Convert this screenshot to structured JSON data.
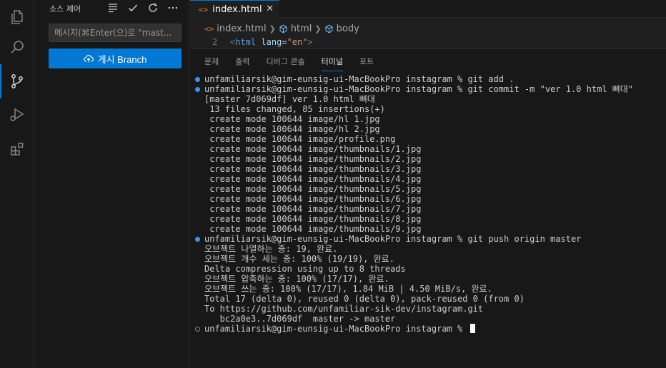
{
  "sidebar": {
    "title": "소스 제어",
    "commit_placeholder": "메시지(⌘Enter(으)로 \"master\"에 커밋)",
    "commit_display": "메시지(⌘Enter(으)로 \"mast...",
    "publish_label": "게시 Branch"
  },
  "editor": {
    "tab": {
      "label": "index.html",
      "icon": "<>",
      "close": "✕"
    },
    "breadcrumb": [
      "index.html",
      "html",
      "body"
    ],
    "code": {
      "line_number": "2",
      "text": "<html lang=\"en\">"
    }
  },
  "panel": {
    "tabs": [
      "문제",
      "출력",
      "디버그 콘솔",
      "터미널",
      "포트"
    ],
    "active_tab": "터미널"
  },
  "terminal": {
    "lines": [
      {
        "text": "unfamiliarsik@gim-eunsig-ui-MacBookPro instagram % git add .",
        "marker": "blue"
      },
      {
        "text": "unfamiliarsik@gim-eunsig-ui-MacBookPro instagram % git commit -m \"ver 1.0 html 뼈대\"",
        "marker": "blue"
      },
      {
        "text": "[master 7d069df] ver 1.0 html 뼈대",
        "marker": ""
      },
      {
        "text": " 13 files changed, 85 insertions(+)",
        "marker": ""
      },
      {
        "text": " create mode 100644 image/hl 1.jpg",
        "marker": ""
      },
      {
        "text": " create mode 100644 image/hl 2.jpg",
        "marker": ""
      },
      {
        "text": " create mode 100644 image/profile.png",
        "marker": ""
      },
      {
        "text": " create mode 100644 image/thumbnails/1.jpg",
        "marker": ""
      },
      {
        "text": " create mode 100644 image/thumbnails/2.jpg",
        "marker": ""
      },
      {
        "text": " create mode 100644 image/thumbnails/3.jpg",
        "marker": ""
      },
      {
        "text": " create mode 100644 image/thumbnails/4.jpg",
        "marker": ""
      },
      {
        "text": " create mode 100644 image/thumbnails/5.jpg",
        "marker": ""
      },
      {
        "text": " create mode 100644 image/thumbnails/6.jpg",
        "marker": ""
      },
      {
        "text": " create mode 100644 image/thumbnails/7.jpg",
        "marker": ""
      },
      {
        "text": " create mode 100644 image/thumbnails/8.jpg",
        "marker": ""
      },
      {
        "text": " create mode 100644 image/thumbnails/9.jpg",
        "marker": ""
      },
      {
        "text": "unfamiliarsik@gim-eunsig-ui-MacBookPro instagram % git push origin master",
        "marker": "blue"
      },
      {
        "text": "오브젝트 나열하는 중: 19, 완료.",
        "marker": ""
      },
      {
        "text": "오브젝트 개수 세는 중: 100% (19/19), 완료.",
        "marker": ""
      },
      {
        "text": "Delta compression using up to 8 threads",
        "marker": ""
      },
      {
        "text": "오브젝트 압축하는 중: 100% (17/17), 완료.",
        "marker": ""
      },
      {
        "text": "오브젝트 쓰는 중: 100% (17/17), 1.84 MiB | 4.50 MiB/s, 완료.",
        "marker": ""
      },
      {
        "text": "Total 17 (delta 0), reused 0 (delta 0), pack-reused 0 (from 0)",
        "marker": ""
      },
      {
        "text": "To https://github.com/unfamiliar-sik-dev/instagram.git",
        "marker": ""
      },
      {
        "text": "   bc2a0e3..7d069df  master -> master",
        "marker": ""
      },
      {
        "text": "unfamiliarsik@gim-eunsig-ui-MacBookPro instagram % ",
        "marker": "hollow"
      }
    ]
  },
  "colors": {
    "accent": "#0078d4",
    "html_icon": "#e37933",
    "blue_marker": "#3794ff"
  }
}
